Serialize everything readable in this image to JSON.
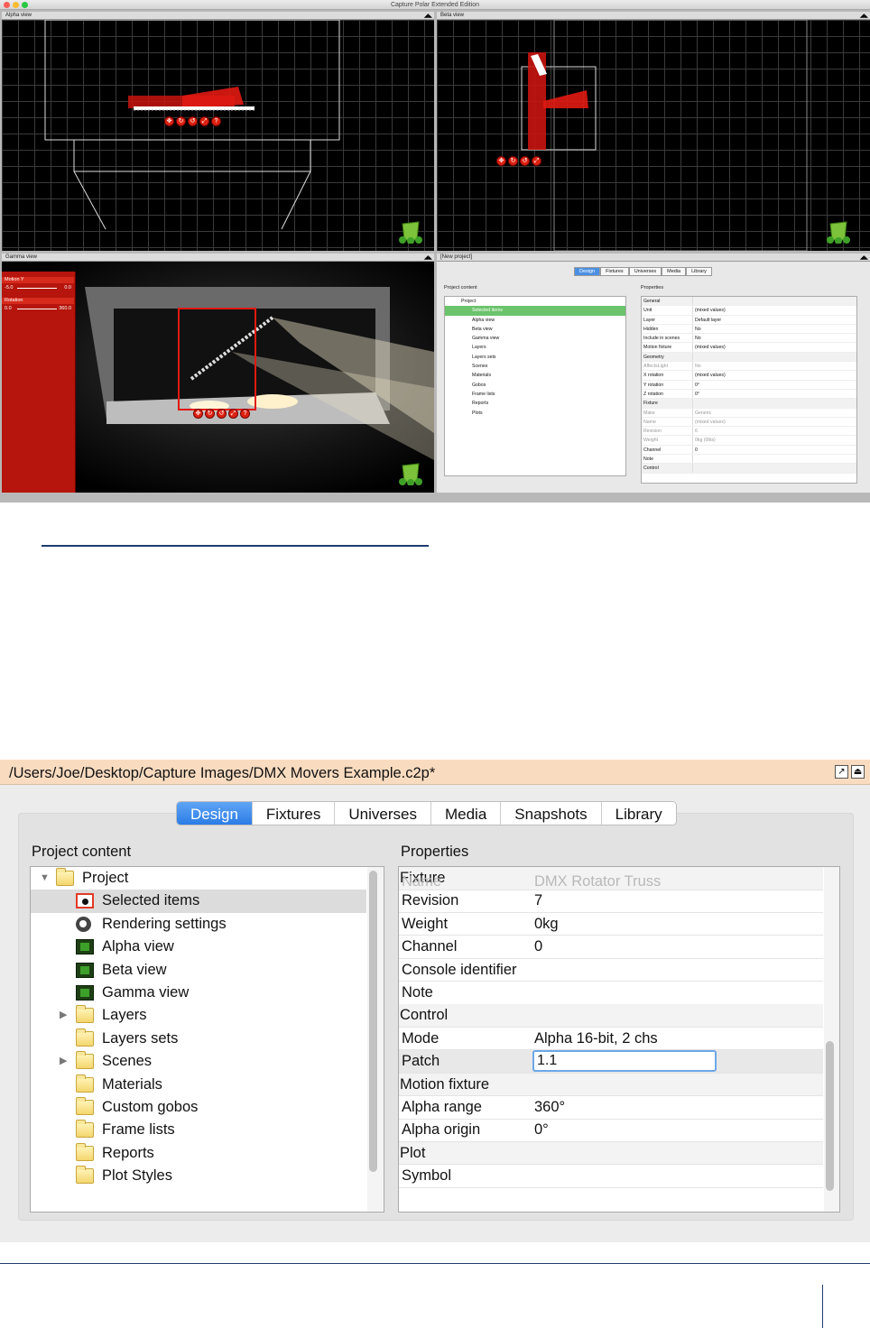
{
  "top": {
    "window_title": "Capture Polar Extended Edition",
    "panes": {
      "alpha": "Alpha view",
      "beta": "Beta view",
      "gamma": "Gamma view",
      "project": "[New project]"
    },
    "gamma_side": {
      "motion_label": "Motion Y",
      "motion_min": "-5.0",
      "motion_max": "0.0",
      "rotation_label": "Rotation",
      "rotation_min": "0.0",
      "rotation_max": "360.0"
    },
    "tabs": [
      "Design",
      "Fixtures",
      "Universes",
      "Media",
      "Library"
    ],
    "project_content_label": "Project content",
    "properties_label": "Properties",
    "tree": [
      "Project",
      "Selected items",
      "Alpha view",
      "Beta view",
      "Gamma view",
      "Layers",
      "Layers sets",
      "Scenes",
      "Materials",
      "Gobos",
      "Frame lists",
      "Reports",
      "Plots"
    ],
    "props": [
      {
        "k": "General",
        "v": "",
        "hdr": true
      },
      {
        "k": "Unit",
        "v": "(mixed values)"
      },
      {
        "k": "Layer",
        "v": "Default layer"
      },
      {
        "k": "Hidden",
        "v": "No"
      },
      {
        "k": "Include in scenes",
        "v": "No"
      },
      {
        "k": "Motion fixture",
        "v": "(mixed values)"
      },
      {
        "k": "Geometry",
        "v": "",
        "hdr": true
      },
      {
        "k": "AffectsLight",
        "v": "No",
        "dim": true
      },
      {
        "k": "X rotation",
        "v": "(mixed values)"
      },
      {
        "k": "Y rotation",
        "v": "0°"
      },
      {
        "k": "Z rotation",
        "v": "0°"
      },
      {
        "k": "Fixture",
        "v": "",
        "hdr": true
      },
      {
        "k": "Make",
        "v": "Generic",
        "dim": true
      },
      {
        "k": "Name",
        "v": "(mixed values)",
        "dim": true
      },
      {
        "k": "Revision",
        "v": "6",
        "dim": true
      },
      {
        "k": "Weight",
        "v": "0kg (0lbs)",
        "dim": true
      },
      {
        "k": "Channel",
        "v": "0"
      },
      {
        "k": "Note",
        "v": ""
      },
      {
        "k": "Control",
        "v": "",
        "hdr": true
      }
    ]
  },
  "bottom": {
    "path": "/Users/Joe/Desktop/Capture Images/DMX Movers Example.c2p*",
    "tabs": [
      "Design",
      "Fixtures",
      "Universes",
      "Media",
      "Snapshots",
      "Library"
    ],
    "project_content_label": "Project content",
    "properties_label": "Properties",
    "tree": [
      {
        "label": "Project",
        "icon": "folder-icon",
        "arrow": "▼"
      },
      {
        "label": "Selected items",
        "icon": "selected-items-icon",
        "sel": true
      },
      {
        "label": "Rendering settings",
        "icon": "rendering-settings-icon"
      },
      {
        "label": "Alpha view",
        "icon": "view-icon"
      },
      {
        "label": "Beta view",
        "icon": "view-icon"
      },
      {
        "label": "Gamma view",
        "icon": "view-icon"
      },
      {
        "label": "Layers",
        "icon": "folder-icon",
        "arrow": "▶"
      },
      {
        "label": "Layers sets",
        "icon": "folder-icon"
      },
      {
        "label": "Scenes",
        "icon": "folder-icon",
        "arrow": "▶"
      },
      {
        "label": "Materials",
        "icon": "folder-icon"
      },
      {
        "label": "Custom gobos",
        "icon": "folder-icon"
      },
      {
        "label": "Frame lists",
        "icon": "folder-icon"
      },
      {
        "label": "Reports",
        "icon": "folder-icon"
      },
      {
        "label": "Plot Styles",
        "icon": "folder-icon"
      }
    ],
    "props_overlap": {
      "hdr": "Fixture",
      "ghost_key": "Name",
      "ghost_value": "DMX Rotator Truss"
    },
    "props": [
      {
        "k": "Revision",
        "v": "7"
      },
      {
        "k": "Weight",
        "v": "0kg"
      },
      {
        "k": "Channel",
        "v": "0"
      },
      {
        "k": "Console identifier",
        "v": ""
      },
      {
        "k": "Note",
        "v": ""
      },
      {
        "k": "Control",
        "v": "",
        "hdr": true
      },
      {
        "k": "Mode",
        "v": "Alpha 16-bit, 2 chs"
      },
      {
        "k": "Patch",
        "v": "1.1",
        "input": true
      },
      {
        "k": "Motion fixture",
        "v": "",
        "hdr": true
      },
      {
        "k": "Alpha range",
        "v": "360°"
      },
      {
        "k": "Alpha origin",
        "v": "0°"
      },
      {
        "k": "Plot",
        "v": "",
        "hdr": true
      },
      {
        "k": "Symbol",
        "v": ""
      }
    ],
    "colors": {
      "path_bar": "#f9dcc0",
      "active_tab": "#2c7ce6",
      "selection_red": "#d21a1a"
    }
  }
}
